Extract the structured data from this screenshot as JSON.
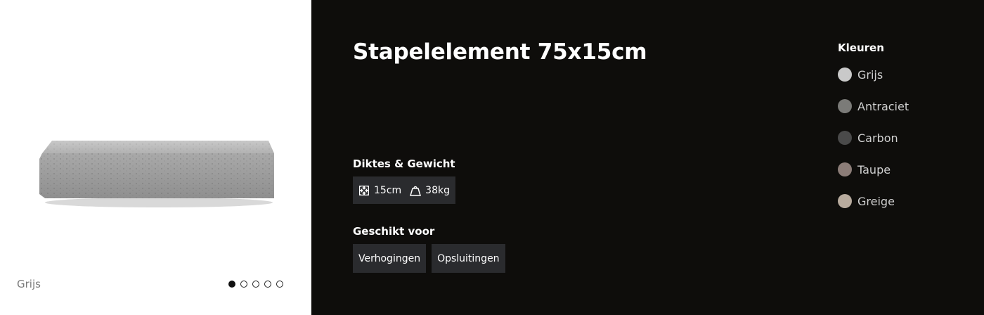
{
  "gallery": {
    "caption": "Grijs",
    "dots": [
      {
        "active": true
      },
      {
        "active": false
      },
      {
        "active": false
      },
      {
        "active": false
      },
      {
        "active": false
      }
    ]
  },
  "product": {
    "title": "Stapelelement 75x15cm"
  },
  "specs": {
    "section_title": "Diktes & Gewicht",
    "thickness": "15cm",
    "weight": "38kg"
  },
  "usage": {
    "section_title": "Geschikt voor",
    "tags": [
      "Verhogingen",
      "Opsluitingen"
    ]
  },
  "colors": {
    "section_title": "Kleuren",
    "items": [
      {
        "label": "Grijs",
        "color": "#c9c9c9"
      },
      {
        "label": "Antraciet",
        "color": "#7b7b78"
      },
      {
        "label": "Carbon",
        "color": "#4a4a4a"
      },
      {
        "label": "Taupe",
        "color": "#8c7d78"
      },
      {
        "label": "Greige",
        "color": "#b8ab9e"
      }
    ]
  }
}
